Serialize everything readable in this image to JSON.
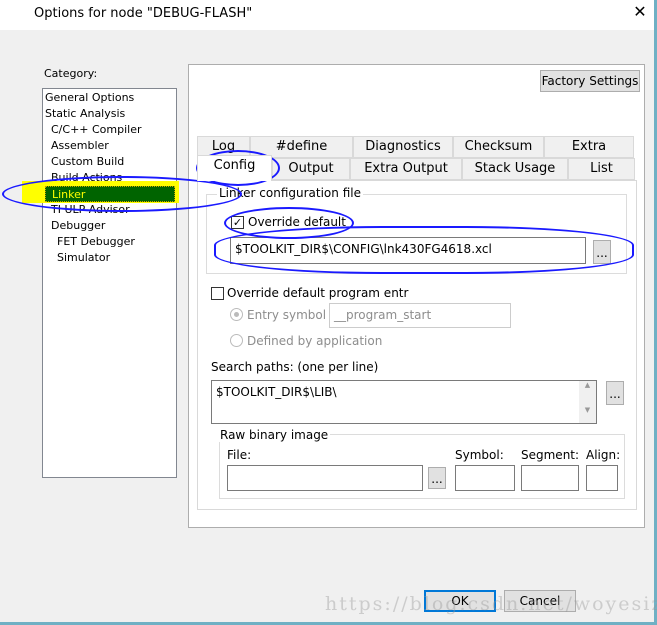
{
  "window": {
    "title": "Options for node \"DEBUG-FLASH\"",
    "close_icon": "close-icon"
  },
  "category": {
    "label": "Category:",
    "items": [
      {
        "label": "General Options",
        "indent": 0
      },
      {
        "label": "Static Analysis",
        "indent": 0
      },
      {
        "label": "C/C++ Compiler",
        "indent": 1
      },
      {
        "label": "Assembler",
        "indent": 1
      },
      {
        "label": "Custom Build",
        "indent": 1
      },
      {
        "label": "Build Actions",
        "indent": 1
      },
      {
        "label": "Linker",
        "indent": 1,
        "selected": true
      },
      {
        "label": "TI ULP Advisor",
        "indent": 1
      },
      {
        "label": "Debugger",
        "indent": 1
      },
      {
        "label": "FET Debugger",
        "indent": 2
      },
      {
        "label": "Simulator",
        "indent": 2
      }
    ]
  },
  "factory_settings": "Factory Settings",
  "tabs_row1": [
    "Log",
    "#define",
    "Diagnostics",
    "Checksum",
    "Extra Options"
  ],
  "tabs_row2": [
    "Config",
    "Output",
    "Extra Output",
    "Stack Usage",
    "List"
  ],
  "active_tab": "Config",
  "config": {
    "linker_group": "Linker configuration file",
    "override_default": "Override default",
    "override_checked": true,
    "config_file": "$TOOLKIT_DIR$\\CONFIG\\lnk430FG4618.xcl",
    "browse": "...",
    "override_entry": "Override default program entr",
    "override_entry_checked": false,
    "entry_symbol": "Entry symbol",
    "entry_symbol_value": "__program_start",
    "defined_by_app": "Defined by application",
    "search_paths_label": "Search paths:  (one per line)",
    "search_paths": "$TOOLKIT_DIR$\\LIB\\",
    "raw_group": "Raw binary image",
    "file_label": "File:",
    "symbol_label": "Symbol:",
    "segment_label": "Segment:",
    "align_label": "Align:"
  },
  "buttons": {
    "ok": "OK",
    "cancel": "Cancel"
  },
  "watermark": "https://blog.csdn.net/woyesizuil",
  "colors": {
    "selection": "#006400",
    "highlight": "#ffff00",
    "annotation": "#1a1aff",
    "ok_border": "#0078d7"
  }
}
